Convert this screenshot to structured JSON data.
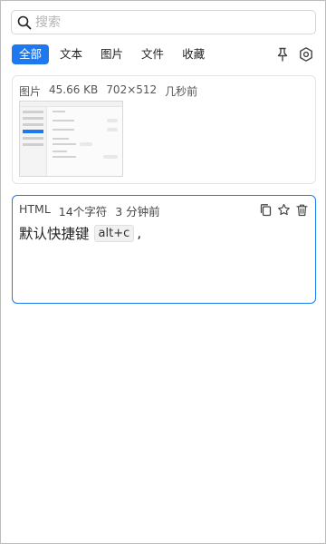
{
  "search": {
    "placeholder": "搜索"
  },
  "tabs": [
    {
      "label": "全部",
      "active": true
    },
    {
      "label": "文本"
    },
    {
      "label": "图片"
    },
    {
      "label": "文件"
    },
    {
      "label": "收藏"
    }
  ],
  "toolbar": {
    "pin_icon": "pin-icon",
    "settings_icon": "settings-icon"
  },
  "items": [
    {
      "type": "图片",
      "size": "45.66 KB",
      "dimensions": "702×512",
      "time": "几秒前",
      "preview_icon": "screenshot-thumbnail"
    },
    {
      "type": "HTML",
      "length": "14个字符",
      "time": "3 分钟前",
      "text": "默认快捷键",
      "kbd": "alt+c",
      "suffix": ",",
      "actions": [
        "copy-icon",
        "star-icon",
        "trash-icon"
      ]
    }
  ],
  "colors": {
    "accent": "#1e78f0",
    "border": "#e4e4e4"
  }
}
